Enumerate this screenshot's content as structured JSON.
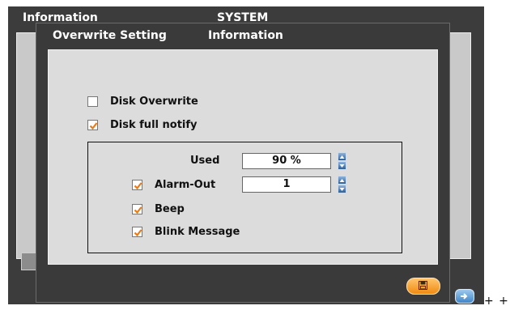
{
  "background_window": {
    "tabs": [
      "Information",
      "SYSTEM"
    ]
  },
  "dialog": {
    "tabs": [
      "Overwrite Setting",
      "Information"
    ],
    "disk_overwrite": {
      "label": "Disk Overwrite",
      "checked": false
    },
    "disk_full_notify": {
      "label": "Disk full notify",
      "checked": true
    },
    "used": {
      "label": "Used",
      "value": "90 %"
    },
    "alarm_out": {
      "label": "Alarm-Out",
      "value": "1",
      "checked": true
    },
    "beep": {
      "label": "Beep",
      "checked": true
    },
    "blink_message": {
      "label": "Blink Message",
      "checked": true
    },
    "save_icon": "save-disk-icon"
  },
  "page_edge_text": "+ +",
  "colors": {
    "check": "#e87a1a",
    "save_button": "#f5a030",
    "nav_button": "#4a90d0",
    "window": "#3a3a3a",
    "panel": "#dcdcdc"
  }
}
